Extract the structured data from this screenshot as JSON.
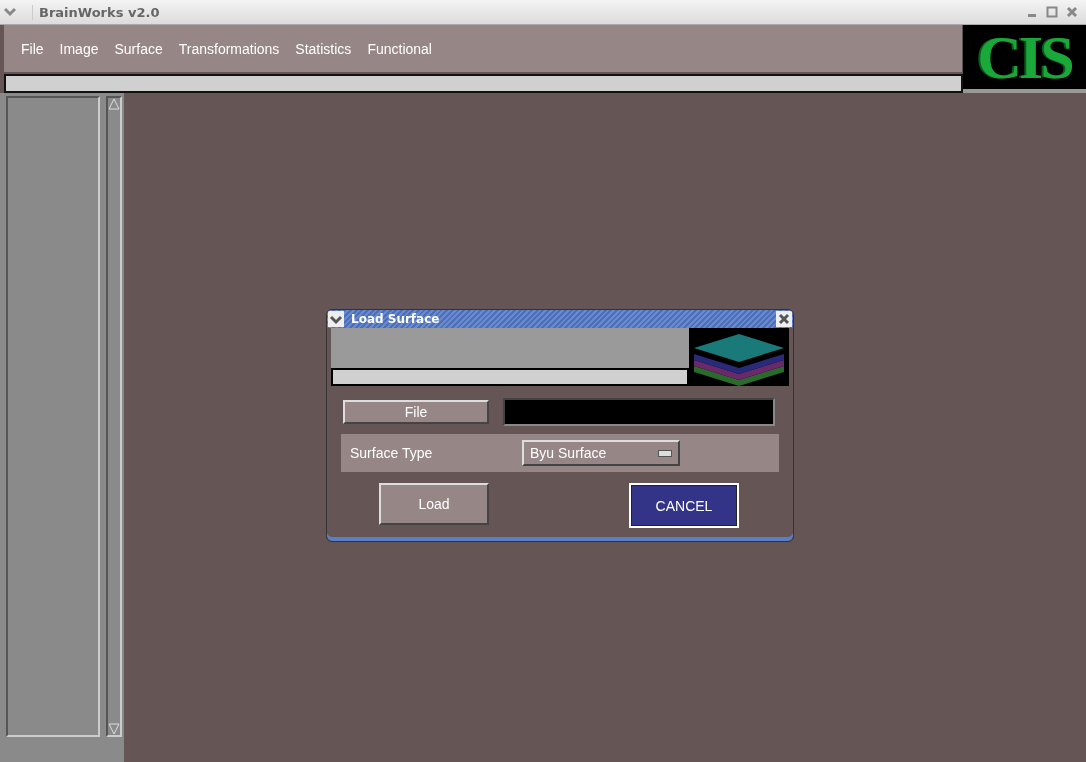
{
  "window": {
    "title": "BrainWorks v2.0"
  },
  "menu": [
    "File",
    "Image",
    "Surface",
    "Transformations",
    "Statistics",
    "Functional"
  ],
  "logo": {
    "text": "CIS"
  },
  "dialog": {
    "title": "Load Surface",
    "file_button": "File",
    "surface_type_label": "Surface Type",
    "surface_type_value": "Byu Surface",
    "buttons": [
      {
        "label": "Load",
        "selected": false
      },
      {
        "label": "CANCEL",
        "selected": true
      }
    ]
  }
}
